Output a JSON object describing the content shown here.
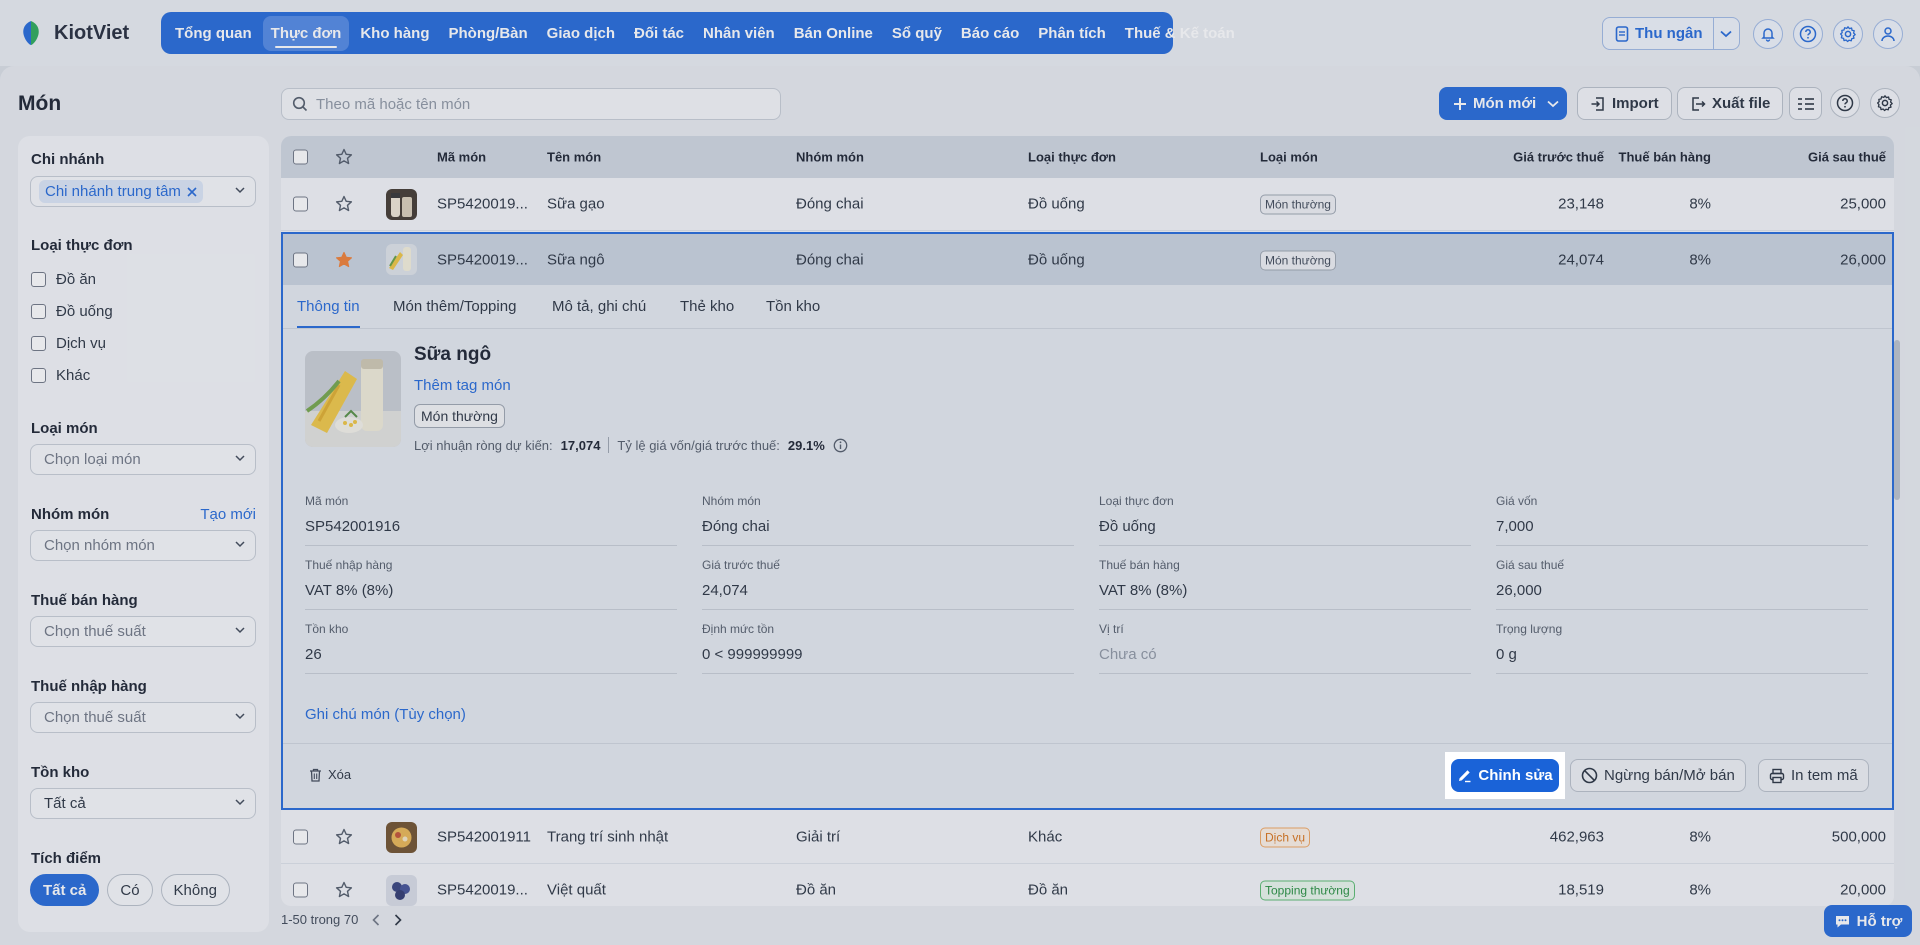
{
  "app": {
    "name": "KiotViet"
  },
  "nav": {
    "items": [
      "Tổng quan",
      "Thực đơn",
      "Kho hàng",
      "Phòng/Bàn",
      "Giao dịch",
      "Đối tác",
      "Nhân viên",
      "Bán Online",
      "Sổ quỹ",
      "Báo cáo",
      "Phân tích",
      "Thuế & Kế toán"
    ],
    "active": "Thực đơn",
    "cashier_label": "Thu ngân"
  },
  "page": {
    "title": "Món"
  },
  "search": {
    "placeholder": "Theo mã hoặc tên món"
  },
  "toolbar": {
    "new_label": "Món mới",
    "import_label": "Import",
    "export_label": "Xuất file"
  },
  "filters": {
    "branch": {
      "label": "Chi nhánh",
      "selected": "Chi nhánh trung tâm"
    },
    "menu_type": {
      "label": "Loại thực đơn",
      "options": [
        "Đồ ăn",
        "Đồ uống",
        "Dịch vụ",
        "Khác"
      ]
    },
    "item_type": {
      "label": "Loại món",
      "placeholder": "Chọn loại món"
    },
    "item_group": {
      "label": "Nhóm món",
      "create_label": "Tạo mới",
      "placeholder": "Chọn nhóm món"
    },
    "sales_tax": {
      "label": "Thuế bán hàng",
      "placeholder": "Chọn thuế suất"
    },
    "import_tax": {
      "label": "Thuế nhập hàng",
      "placeholder": "Chọn thuế suất"
    },
    "stock": {
      "label": "Tồn kho",
      "value": "Tất cả"
    },
    "points": {
      "label": "Tích điểm",
      "options": [
        "Tất cả",
        "Có",
        "Không"
      ],
      "active": "Tất cả"
    }
  },
  "table": {
    "columns": [
      "Mã món",
      "Tên món",
      "Nhóm món",
      "Loại thực đơn",
      "Loại món",
      "Giá trước thuế",
      "Thuế bán hàng",
      "Giá sau thuế"
    ],
    "rows": [
      {
        "code": "SP5420019...",
        "name": "Sữa gạo",
        "group": "Đóng chai",
        "menu_type": "Đồ uống",
        "type": "Món thường",
        "type_style": "default",
        "pre_tax": "23,148",
        "tax": "8%",
        "post_tax": "25,000",
        "starred": false
      },
      {
        "code": "SP5420019...",
        "name": "Sữa ngô",
        "group": "Đóng chai",
        "menu_type": "Đồ uống",
        "type": "Món thường",
        "type_style": "default",
        "pre_tax": "24,074",
        "tax": "8%",
        "post_tax": "26,000",
        "starred": true
      },
      {
        "code": "SP542001911",
        "name": "Trang trí sinh nhật",
        "group": "Giải trí",
        "menu_type": "Khác",
        "type": "Dịch vụ",
        "type_style": "orange",
        "pre_tax": "462,963",
        "tax": "8%",
        "post_tax": "500,000",
        "starred": false
      },
      {
        "code": "SP5420019...",
        "name": "Việt quất",
        "group": "Đồ ăn",
        "menu_type": "Đồ ăn",
        "type": "Topping thường",
        "type_style": "green",
        "pre_tax": "18,519",
        "tax": "8%",
        "post_tax": "20,000",
        "starred": false
      }
    ]
  },
  "detail": {
    "tabs": [
      "Thông tin",
      "Món thêm/Topping",
      "Mô tả, ghi chú",
      "Thẻ kho",
      "Tồn kho"
    ],
    "active_tab": "Thông tin",
    "title": "Sữa ngô",
    "add_tag": "Thêm tag món",
    "tag": "Món thường",
    "profit_label": "Lợi nhuận ròng dự kiến:",
    "profit_value": "17,074",
    "ratio_label": "Tỷ lệ giá vốn/giá trước thuế:",
    "ratio_value": "29.1%",
    "fields": [
      {
        "label": "Mã món",
        "value": "SP542001916"
      },
      {
        "label": "Nhóm món",
        "value": "Đóng chai"
      },
      {
        "label": "Loại thực đơn",
        "value": "Đồ uống"
      },
      {
        "label": "Giá vốn",
        "value": "7,000"
      },
      {
        "label": "Thuế nhập hàng",
        "value": "VAT 8% (8%)"
      },
      {
        "label": "Giá trước thuế",
        "value": "24,074"
      },
      {
        "label": "Thuế bán hàng",
        "value": "VAT 8% (8%)"
      },
      {
        "label": "Giá sau thuế",
        "value": "26,000"
      },
      {
        "label": "Tồn kho",
        "value": "26"
      },
      {
        "label": "Định mức tồn",
        "value": "0 < 999999999"
      },
      {
        "label": "Vị trí",
        "value": "Chưa có"
      },
      {
        "label": "Trọng lượng",
        "value": "0 g"
      }
    ],
    "note_link": "Ghi chú món (Tùy chọn)",
    "delete_label": "Xóa",
    "edit_label": "Chỉnh sửa",
    "stop_label": "Ngừng bán/Mở bán",
    "print_label": "In tem mã"
  },
  "pagination": {
    "info": "1-50 trong 70"
  },
  "help": {
    "label": "Hỗ trợ"
  },
  "colors": {
    "primary": "#1a63d8",
    "star": "#f07a2c"
  }
}
